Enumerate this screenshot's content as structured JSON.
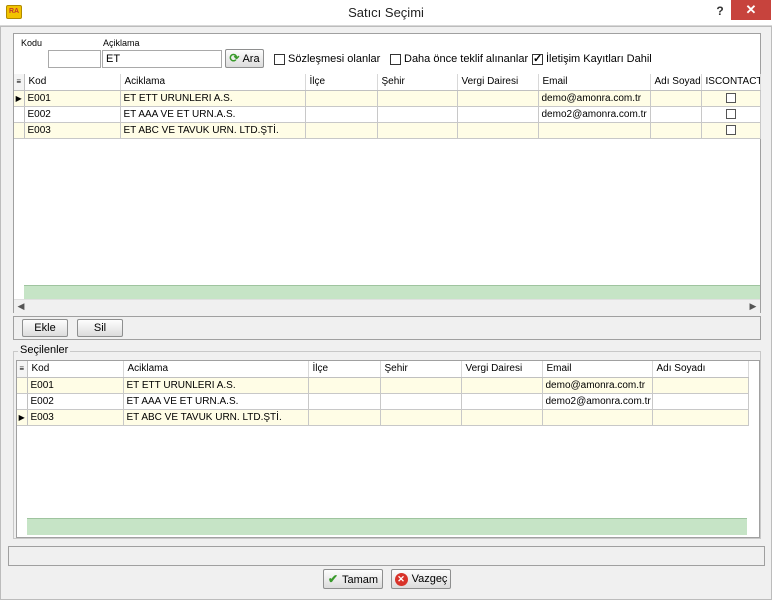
{
  "window": {
    "title": "Satıcı Seçimi",
    "help": "?",
    "close": "✕",
    "app_icon": "RA"
  },
  "filters": {
    "kodu_label": "Kodu",
    "kodu_value": "",
    "aciklama_label": "Açiklama",
    "aciklama_value": "ET",
    "ara_label": "Ara",
    "sozlesme_label": "Sözleşmesi olanlar",
    "sozlesme_checked": false,
    "teklif_label": "Daha önce teklif alınanlar",
    "teklif_checked": false,
    "iletisim_label": "İletişim Kayıtları Dahil",
    "iletisim_checked": true
  },
  "top_grid": {
    "columns": [
      "Kod",
      "Aciklama",
      "İlçe",
      "Şehir",
      "Vergi Dairesi",
      "Email",
      "Adı Soyadı",
      "ISCONTACT"
    ],
    "rows": [
      {
        "kod": "E001",
        "aciklama": "ET ETT URUNLERI A.S.",
        "ilce": "",
        "sehir": "",
        "vergi": "",
        "email": "demo@amonra.com.tr",
        "adi": "",
        "iscontact": false
      },
      {
        "kod": "E002",
        "aciklama": "ET AAA VE ET URN.A.S.",
        "ilce": "",
        "sehir": "",
        "vergi": "",
        "email": "demo2@amonra.com.tr",
        "adi": "",
        "iscontact": false
      },
      {
        "kod": "E003",
        "aciklama": "ET ABC VE TAVUK URN. LTD.ŞTİ.",
        "ilce": "",
        "sehir": "",
        "vergi": "",
        "email": "",
        "adi": "",
        "iscontact": false
      }
    ]
  },
  "actions": {
    "ekle_label": "Ekle",
    "sil_label": "Sil"
  },
  "selected": {
    "group_title": "Seçilenler",
    "columns": [
      "Kod",
      "Aciklama",
      "İlçe",
      "Şehir",
      "Vergi Dairesi",
      "Email",
      "Adı Soyadı"
    ],
    "rows": [
      {
        "kod": "E001",
        "aciklama": "ET ETT URUNLERI A.S.",
        "ilce": "",
        "sehir": "",
        "vergi": "",
        "email": "demo@amonra.com.tr",
        "adi": ""
      },
      {
        "kod": "E002",
        "aciklama": "ET AAA VE ET URN.A.S.",
        "ilce": "",
        "sehir": "",
        "vergi": "",
        "email": "demo2@amonra.com.tr",
        "adi": ""
      },
      {
        "kod": "E003",
        "aciklama": "ET ABC VE TAVUK URN. LTD.ŞTİ.",
        "ilce": "",
        "sehir": "",
        "vergi": "",
        "email": "",
        "adi": ""
      }
    ]
  },
  "footer": {
    "ok_label": "Tamam",
    "cancel_label": "Vazgeç"
  }
}
